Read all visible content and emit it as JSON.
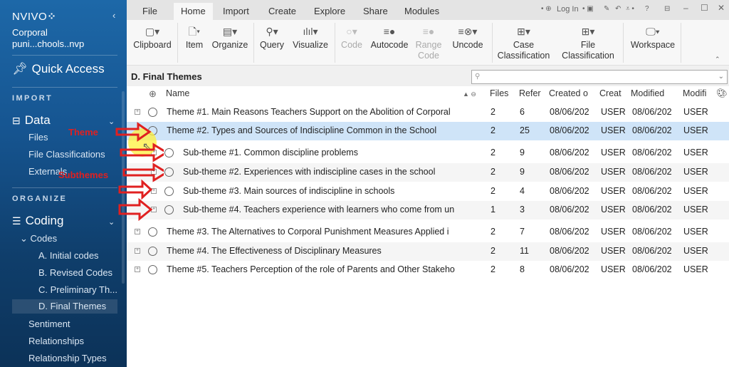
{
  "app": {
    "logo": "NVIVO",
    "logo_mark": "⁘",
    "project": [
      "Corporal",
      "puni...chools..nvp"
    ]
  },
  "sidebar": {
    "quick_access": "Quick Access",
    "sections": {
      "import": "IMPORT",
      "organize": "ORGANIZE"
    },
    "data_group": "Data",
    "data_items": [
      "Files",
      "File Classifications",
      "Externals"
    ],
    "coding_group": "Coding",
    "codes_label": "Codes",
    "code_items": [
      "A. Initial codes",
      "B. Revised Codes",
      "C. Preliminary Th...",
      "D. Final Themes"
    ],
    "other_items": [
      "Sentiment",
      "Relationships",
      "Relationship Types"
    ],
    "selected": "D. Final Themes"
  },
  "menu_tabs": [
    "File",
    "Home",
    "Import",
    "Create",
    "Explore",
    "Share",
    "Modules"
  ],
  "active_tab": "Home",
  "title_controls": {
    "login": "Log In",
    "help": "?",
    "minimize": "–",
    "maximize": "☐",
    "close": "✕"
  },
  "ribbon": [
    {
      "label": "Clipboard",
      "icon": "clipboard-icon",
      "glyph": "📋︎",
      "enabled": true
    },
    {
      "label": "Item",
      "icon": "new-item-icon",
      "glyph": "🗋",
      "enabled": true
    },
    {
      "label": "Organize",
      "icon": "organize-icon",
      "glyph": "▤",
      "enabled": true
    },
    {
      "label": "Query",
      "icon": "query-icon",
      "glyph": "🔍︎",
      "enabled": true
    },
    {
      "label": "Visualize",
      "icon": "visualize-icon",
      "glyph": "📊︎",
      "enabled": true
    },
    {
      "label": "Code",
      "icon": "code-icon",
      "glyph": "○",
      "enabled": false
    },
    {
      "label": "Autocode",
      "icon": "autocode-icon",
      "glyph": "≡●",
      "enabled": true
    },
    {
      "label": "Range Code",
      "icon": "range-code-icon",
      "glyph": "≡●",
      "enabled": false
    },
    {
      "label": "Uncode",
      "icon": "uncode-icon",
      "glyph": "≡⊗",
      "enabled": true
    },
    {
      "label": "Case Classification",
      "icon": "case-classification-icon",
      "glyph": "⊞",
      "enabled": true
    },
    {
      "label": "File Classification",
      "icon": "file-classification-icon",
      "glyph": "⊞",
      "enabled": true
    },
    {
      "label": "Workspace",
      "icon": "workspace-icon",
      "glyph": "🖵",
      "enabled": true
    }
  ],
  "view": {
    "title": "D. Final Themes",
    "search_placeholder": ""
  },
  "columns": {
    "name": "Name",
    "files": "Files",
    "references": "Refer",
    "created_on": "Created o",
    "created_by": "Creat",
    "modified_on": "Modified",
    "modified_by": "Modifi"
  },
  "rows": [
    {
      "name": "Theme #1. Main Reasons Teachers Support on the Abolition of Corporal",
      "files": "2",
      "refs": "6",
      "created": "08/06/202",
      "cby": "USER",
      "modified": "08/06/202",
      "mby": "USER",
      "level": 0,
      "expand": true
    },
    {
      "name": "Theme #2. Types and Sources of Indiscipline Common in the School",
      "files": "2",
      "refs": "25",
      "created": "08/06/202",
      "cby": "USER",
      "modified": "08/06/202",
      "mby": "USER",
      "level": 0,
      "expand": false,
      "selected": true
    },
    {
      "name": "Sub-theme #1. Common discipline problems",
      "files": "2",
      "refs": "9",
      "created": "08/06/202",
      "cby": "USER",
      "modified": "08/06/202",
      "mby": "USER",
      "level": 1,
      "expand": true
    },
    {
      "name": "Sub-theme #2. Experiences with indiscipline cases in the school",
      "files": "2",
      "refs": "9",
      "created": "08/06/202",
      "cby": "USER",
      "modified": "08/06/202",
      "mby": "USER",
      "level": 1,
      "expand": true
    },
    {
      "name": "Sub-theme #3. Main sources of indiscipline in schools",
      "files": "2",
      "refs": "4",
      "created": "08/06/202",
      "cby": "USER",
      "modified": "08/06/202",
      "mby": "USER",
      "level": 1,
      "expand": true
    },
    {
      "name": "Sub-theme #4. Teachers experience with learners who come from un",
      "files": "1",
      "refs": "3",
      "created": "08/06/202",
      "cby": "USER",
      "modified": "08/06/202",
      "mby": "USER",
      "level": 1,
      "expand": true
    },
    {
      "name": "Theme #3. The Alternatives to Corporal Punishment Measures Applied i",
      "files": "2",
      "refs": "7",
      "created": "08/06/202",
      "cby": "USER",
      "modified": "08/06/202",
      "mby": "USER",
      "level": 0,
      "expand": true
    },
    {
      "name": "Theme #4. The Effectiveness of Disciplinary Measures",
      "files": "2",
      "refs": "11",
      "created": "08/06/202",
      "cby": "USER",
      "modified": "08/06/202",
      "mby": "USER",
      "level": 0,
      "expand": true
    },
    {
      "name": "Theme #5. Teachers Perception of the role of Parents and Other Stakeho",
      "files": "2",
      "refs": "8",
      "created": "08/06/202",
      "cby": "USER",
      "modified": "08/06/202",
      "mby": "USER",
      "level": 0,
      "expand": true
    }
  ],
  "annotations": {
    "theme": "Theme",
    "subthemes": "Subthemes",
    "color": "#e02020"
  }
}
